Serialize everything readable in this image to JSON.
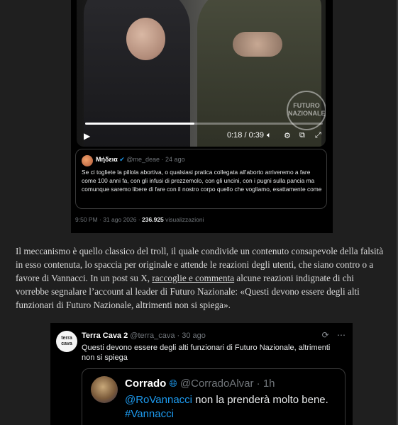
{
  "video": {
    "watermark": "FUTURO NAZIONALE",
    "time": "0:18 / 0:39",
    "progress": 0.46
  },
  "quoted_tweet": {
    "name": "Μήδεια",
    "handle": "@me_deae",
    "age": "24 ago",
    "text": "Se ci togliete la pillola abortiva, o qualsiasi pratica collegata all'aborto arriveremo a fare come 100 anni fa, con gli infusi di prezzemolo, con gli uncini, con i pugni sulla pancia ma comunque saremo libere di fare con il nostro corpo quello che vogliamo, esattamente come"
  },
  "tweet_meta": {
    "datetime": "9:50 PM · 31 ago 2026 ·",
    "views": "236.925",
    "views_label": "visualizzazioni"
  },
  "article": {
    "text_before": "Il meccanismo è quello classico del troll, il quale condivide un contenuto consapevole della falsità in esso contenuta, lo spaccia per originale e attende le reazioni degli utenti, che siano contro o a favore di Vannacci. In un post su X, ",
    "link_text": "raccoglie e commenta",
    "text_after": " alcune reazioni indignate di chi vorrebbe segnalare l’account al leader di Futuro Nazionale: «Questi devono essere degli alti funzionari di Futuro Nazionale, altrimenti non si spiega»."
  },
  "second_tweet": {
    "avatar_text": "terra cava",
    "name": "Terra Cava 2",
    "handle": "@terra_cava",
    "age": "30 ago",
    "text": "Questi devono essere degli alti funzionari di Futuro Nazionale, altrimenti non si spiega",
    "quoted": {
      "name": "Corrado",
      "handle": "@CorradoAlvar",
      "age": "1h",
      "mention": "@RoVannacci",
      "text": " non la prenderà molto bene.",
      "hashtag": "#Vannacci"
    }
  }
}
